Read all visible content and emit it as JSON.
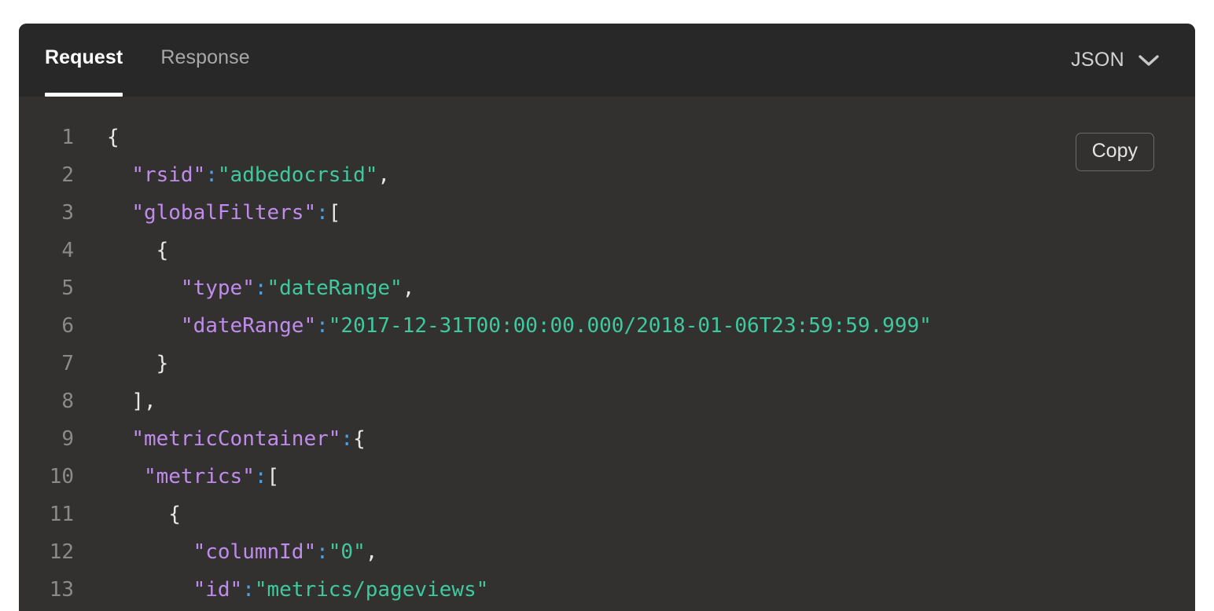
{
  "panel": {
    "tabs": [
      {
        "label": "Request",
        "active": true
      },
      {
        "label": "Response",
        "active": false
      }
    ],
    "format_selector": {
      "value": "JSON",
      "icon": "chevron-down-icon"
    },
    "copy_button_label": "Copy"
  },
  "colors": {
    "page_background": "#ffffff",
    "panel_background": "#333130",
    "header_background": "#282828",
    "tab_active_text": "#ffffff",
    "tab_inactive_text": "#a8a8a8",
    "tab_underline": "#ffffff",
    "line_number": "#8a8a8a",
    "punctuation": "#e8e8e8",
    "json_key": "#c08cec",
    "json_colon": "#4ca2e8",
    "json_string": "#3ec99f",
    "copy_border": "#6b6b6b"
  },
  "code": {
    "language": "JSON",
    "lines": [
      {
        "number": "1",
        "indent": 0,
        "tokens": [
          {
            "t": "punc",
            "v": "{"
          }
        ]
      },
      {
        "number": "2",
        "indent": 2,
        "tokens": [
          {
            "t": "key",
            "v": "\"rsid\""
          },
          {
            "t": "colon",
            "v": ":"
          },
          {
            "t": "str",
            "v": "\"adbedocrsid\""
          },
          {
            "t": "punc",
            "v": ","
          }
        ]
      },
      {
        "number": "3",
        "indent": 2,
        "tokens": [
          {
            "t": "key",
            "v": "\"globalFilters\""
          },
          {
            "t": "colon",
            "v": ":"
          },
          {
            "t": "punc",
            "v": "["
          }
        ]
      },
      {
        "number": "4",
        "indent": 4,
        "tokens": [
          {
            "t": "punc",
            "v": "{"
          }
        ]
      },
      {
        "number": "5",
        "indent": 6,
        "tokens": [
          {
            "t": "key",
            "v": "\"type\""
          },
          {
            "t": "colon",
            "v": ":"
          },
          {
            "t": "str",
            "v": "\"dateRange\""
          },
          {
            "t": "punc",
            "v": ","
          }
        ]
      },
      {
        "number": "6",
        "indent": 6,
        "tokens": [
          {
            "t": "key",
            "v": "\"dateRange\""
          },
          {
            "t": "colon",
            "v": ":"
          },
          {
            "t": "str",
            "v": "\"2017-12-31T00:00:00.000/2018-01-06T23:59:59.999\""
          }
        ]
      },
      {
        "number": "7",
        "indent": 4,
        "tokens": [
          {
            "t": "punc",
            "v": "}"
          }
        ]
      },
      {
        "number": "8",
        "indent": 2,
        "tokens": [
          {
            "t": "punc",
            "v": "],"
          }
        ]
      },
      {
        "number": "9",
        "indent": 2,
        "tokens": [
          {
            "t": "key",
            "v": "\"metricContainer\""
          },
          {
            "t": "colon",
            "v": ":"
          },
          {
            "t": "punc",
            "v": "{"
          }
        ]
      },
      {
        "number": "10",
        "indent": 3,
        "tokens": [
          {
            "t": "key",
            "v": "\"metrics\""
          },
          {
            "t": "colon",
            "v": ":"
          },
          {
            "t": "punc",
            "v": "["
          }
        ]
      },
      {
        "number": "11",
        "indent": 5,
        "tokens": [
          {
            "t": "punc",
            "v": "{"
          }
        ]
      },
      {
        "number": "12",
        "indent": 7,
        "tokens": [
          {
            "t": "key",
            "v": "\"columnId\""
          },
          {
            "t": "colon",
            "v": ":"
          },
          {
            "t": "str",
            "v": "\"0\""
          },
          {
            "t": "punc",
            "v": ","
          }
        ]
      },
      {
        "number": "13",
        "indent": 7,
        "tokens": [
          {
            "t": "key",
            "v": "\"id\""
          },
          {
            "t": "colon",
            "v": ":"
          },
          {
            "t": "str",
            "v": "\"metrics/pageviews\""
          }
        ]
      }
    ]
  }
}
